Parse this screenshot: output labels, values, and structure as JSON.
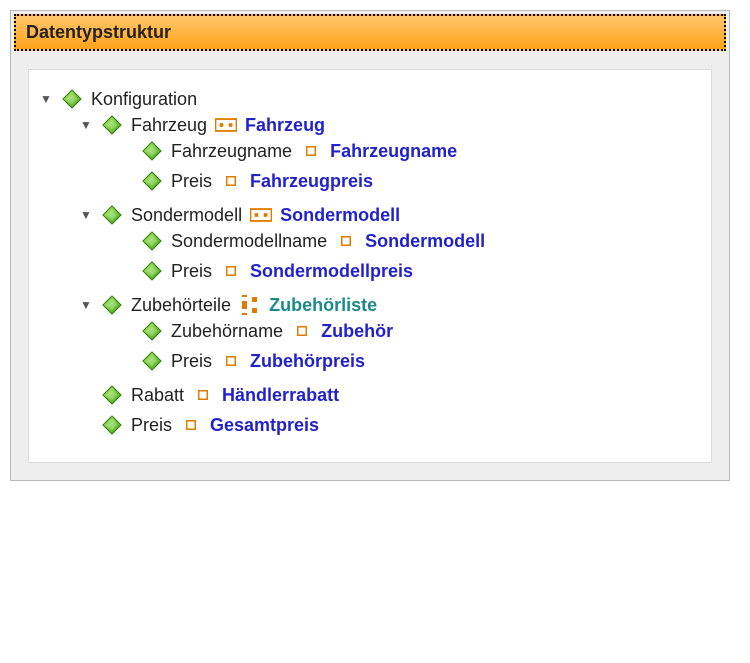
{
  "header": {
    "title": "Datentypstruktur"
  },
  "icons": {
    "diamond": "diamond-icon",
    "dual_square": "dual-square-icon",
    "small_square": "small-square-icon",
    "list_frame": "list-frame-icon"
  },
  "tree": {
    "root": {
      "label": "Konfiguration",
      "expanded": true,
      "children": [
        {
          "label": "Fahrzeug",
          "ref": "Fahrzeug",
          "ref_icon": "dual_square",
          "ref_style": "blue",
          "expanded": true,
          "children": [
            {
              "label": "Fahrzeugname",
              "ref": "Fahrzeugname",
              "ref_icon": "small_square",
              "ref_style": "blue"
            },
            {
              "label": "Preis",
              "ref": "Fahrzeugpreis",
              "ref_icon": "small_square",
              "ref_style": "blue"
            }
          ]
        },
        {
          "label": "Sondermodell",
          "ref": "Sondermodell",
          "ref_icon": "dual_square",
          "ref_style": "blue",
          "expanded": true,
          "children": [
            {
              "label": "Sondermodellname",
              "ref": "Sondermodell",
              "ref_icon": "small_square",
              "ref_style": "blue"
            },
            {
              "label": "Preis",
              "ref": "Sondermodellpreis",
              "ref_icon": "small_square",
              "ref_style": "blue"
            }
          ]
        },
        {
          "label": "Zubehörteile",
          "ref": "Zubehörliste",
          "ref_icon": "list_frame",
          "ref_style": "teal",
          "expanded": true,
          "children": [
            {
              "label": "Zubehörname",
              "ref": "Zubehör",
              "ref_icon": "small_square",
              "ref_style": "blue"
            },
            {
              "label": "Preis",
              "ref": "Zubehörpreis",
              "ref_icon": "small_square",
              "ref_style": "blue"
            }
          ]
        },
        {
          "label": "Rabatt",
          "ref": "Händlerrabatt",
          "ref_icon": "small_square",
          "ref_style": "blue"
        },
        {
          "label": "Preis",
          "ref": "Gesamtpreis",
          "ref_icon": "small_square",
          "ref_style": "blue"
        }
      ]
    }
  }
}
